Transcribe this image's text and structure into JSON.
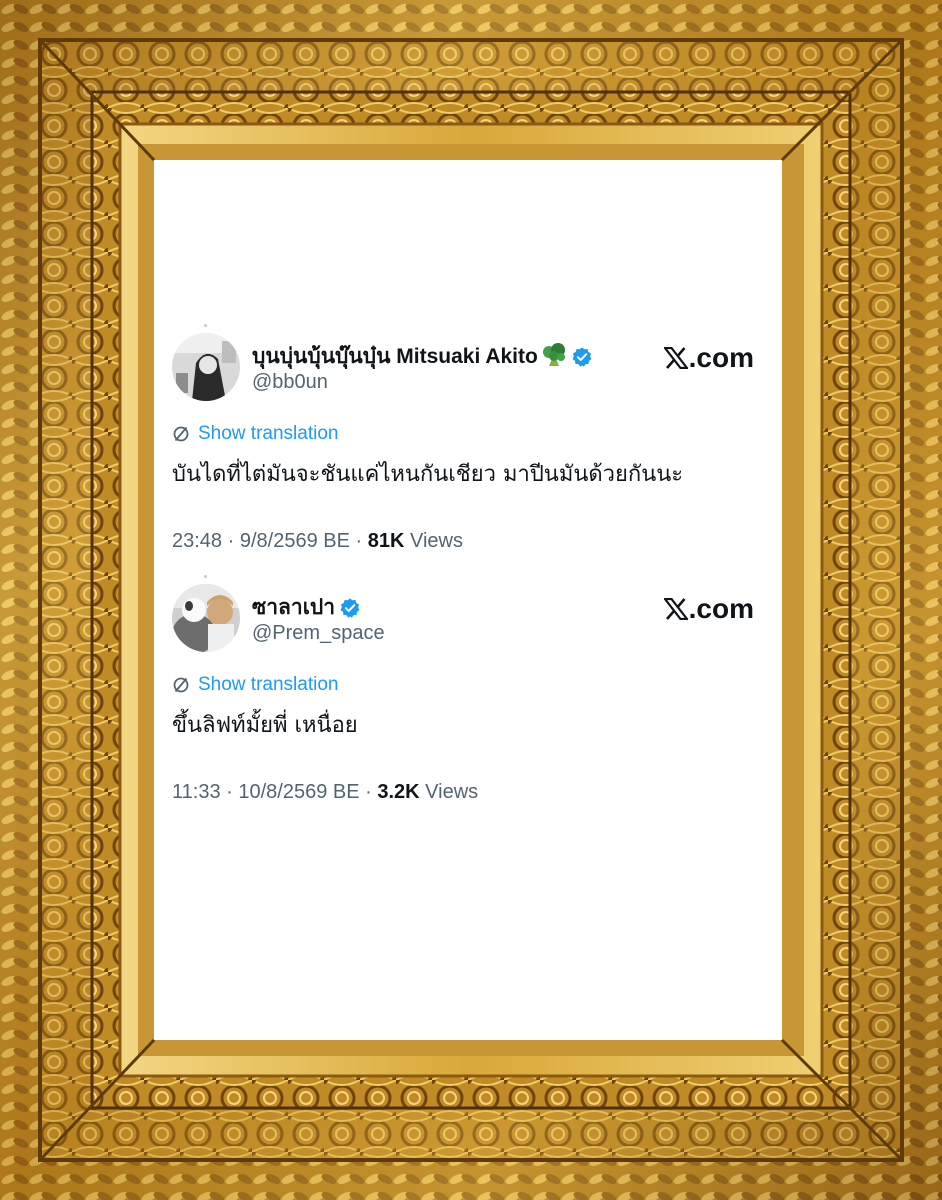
{
  "tweets": [
    {
      "display_name": "บุนบุ่นบุ้นบุ๊นบุ๋น Mitsuaki Akito",
      "name_emoji": "🥦",
      "handle": "@bb0un",
      "brand": ".com",
      "translate_label": "Show translation",
      "text": "บันไดที่ไต่มันจะชันแค่ไหนกันเชียว มาปีนมันด้วยกันนะ",
      "time": "23:48",
      "date": "9/8/2569 BE",
      "views_count": "81K",
      "views_label": "Views",
      "sep": " · "
    },
    {
      "display_name": "ซาลาเปา",
      "name_emoji": "",
      "handle": "@Prem_space",
      "brand": ".com",
      "translate_label": "Show translation",
      "text": "ขึ้นลิฟท์มั้ยพี่ เหนื่อย",
      "time": "11:33",
      "date": "10/8/2569 BE",
      "views_count": "3.2K",
      "views_label": "Views",
      "sep": " · "
    }
  ],
  "colors": {
    "verified": "#1d9bf0",
    "link": "#1d9bf0",
    "secondary_text": "#536471",
    "primary_text": "#0f1419",
    "frame_gold": "#c9962a"
  }
}
